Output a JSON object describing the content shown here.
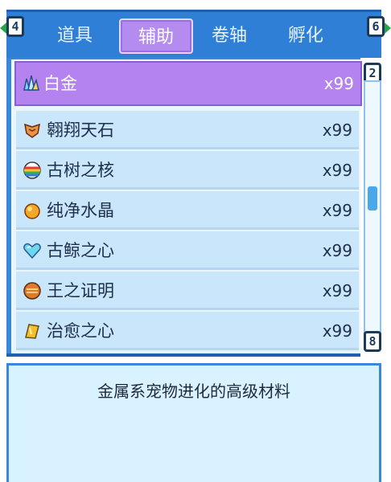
{
  "tabs": [
    {
      "label": "道具",
      "active": false
    },
    {
      "label": "辅助",
      "active": true
    },
    {
      "label": "卷轴",
      "active": false
    },
    {
      "label": "孵化",
      "active": false
    }
  ],
  "page_nav": {
    "prev_badge": "4",
    "next_badge": "6"
  },
  "list": {
    "items": [
      {
        "label": "白金",
        "qty": "x99",
        "icon": "crystal-cluster-icon",
        "selected": true
      },
      {
        "label": "翱翔天石",
        "qty": "x99",
        "icon": "winged-stone-icon",
        "selected": false
      },
      {
        "label": "古树之核",
        "qty": "x99",
        "icon": "rainbow-orb-icon",
        "selected": false
      },
      {
        "label": "纯净水晶",
        "qty": "x99",
        "icon": "orange-crystal-icon",
        "selected": false
      },
      {
        "label": "古鲸之心",
        "qty": "x99",
        "icon": "heart-icon",
        "selected": false
      },
      {
        "label": "王之证明",
        "qty": "x99",
        "icon": "royal-medal-icon",
        "selected": false
      },
      {
        "label": "治愈之心",
        "qty": "x99",
        "icon": "healing-gem-icon",
        "selected": false
      }
    ]
  },
  "scrollbar": {
    "top_badge": "2",
    "bottom_badge": "8",
    "position": 0.45
  },
  "description": {
    "text": "金属系宠物进化的高级材料"
  },
  "colors": {
    "header_blue": "#2f7fd6",
    "selected_purple": "#b583ef",
    "row_blue": "#c9e6fb",
    "desc_bg": "#d9f2ff"
  }
}
